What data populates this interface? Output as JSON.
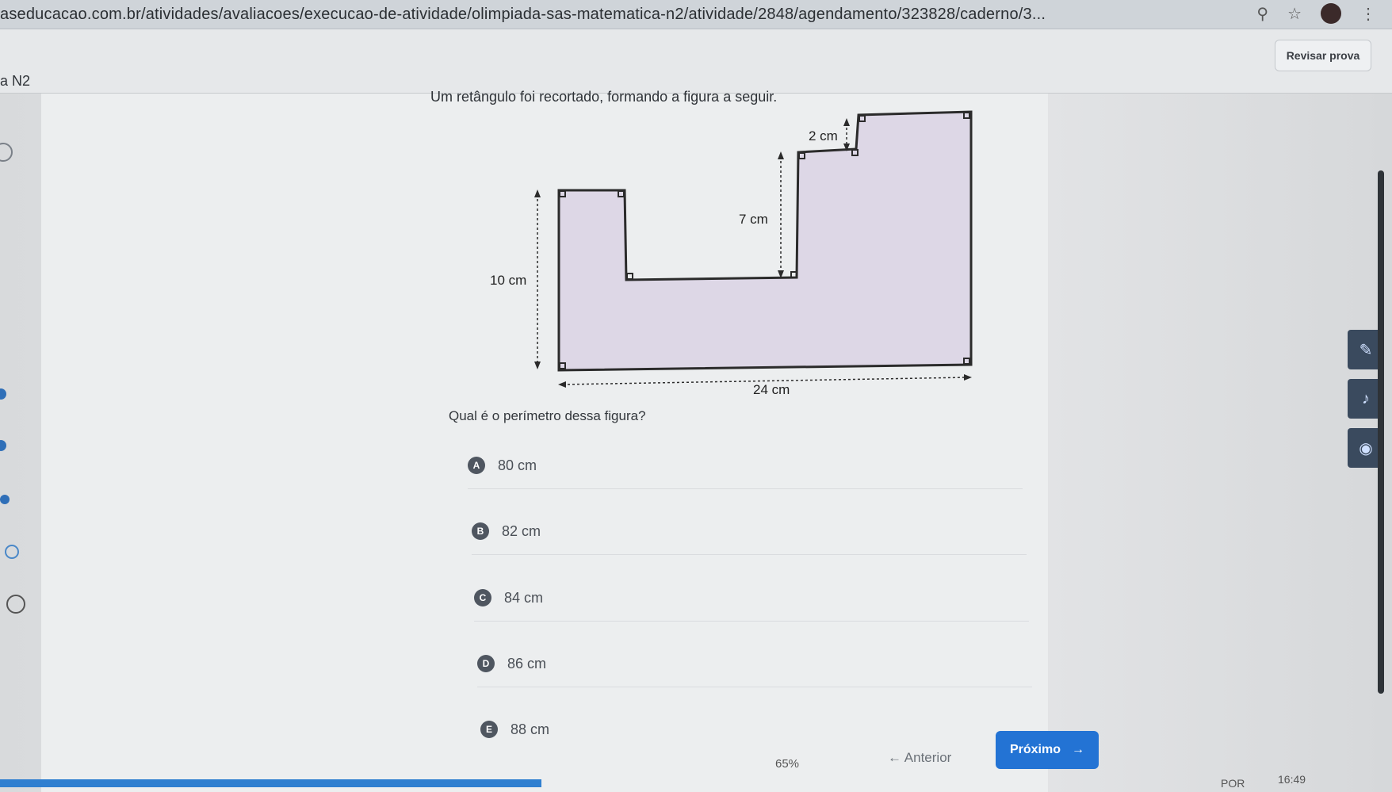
{
  "browser": {
    "url": "aseducacao.com.br/atividades/avaliacoes/execucao-de-atividade/olimpiada-sas-matematica-n2/atividade/2848/agendamento/323828/caderno/3..."
  },
  "header": {
    "page_tag": "a N2",
    "review_button": "Revisar prova"
  },
  "question": {
    "statement": "Um retângulo foi recortado, formando a figura a seguir.",
    "prompt": "Qual é o perímetro dessa figura?",
    "figure_labels": {
      "top_step": "2 cm",
      "inner_height": "7 cm",
      "left_height": "10 cm",
      "bottom_width": "24 cm"
    },
    "options": [
      {
        "letter": "A",
        "text": "80 cm"
      },
      {
        "letter": "B",
        "text": "82 cm"
      },
      {
        "letter": "C",
        "text": "84 cm"
      },
      {
        "letter": "D",
        "text": "86 cm"
      },
      {
        "letter": "E",
        "text": "88 cm"
      }
    ]
  },
  "footer": {
    "progress_text": "65%",
    "progress_value": 0.65,
    "prev_label": "← Anterior",
    "next_label": "Próximo",
    "next_arrow": "→"
  },
  "taskbar": {
    "lang": "POR",
    "time": "16:49"
  },
  "colors": {
    "accent": "#2373d4",
    "shape_fill": "#ddd7e6"
  }
}
